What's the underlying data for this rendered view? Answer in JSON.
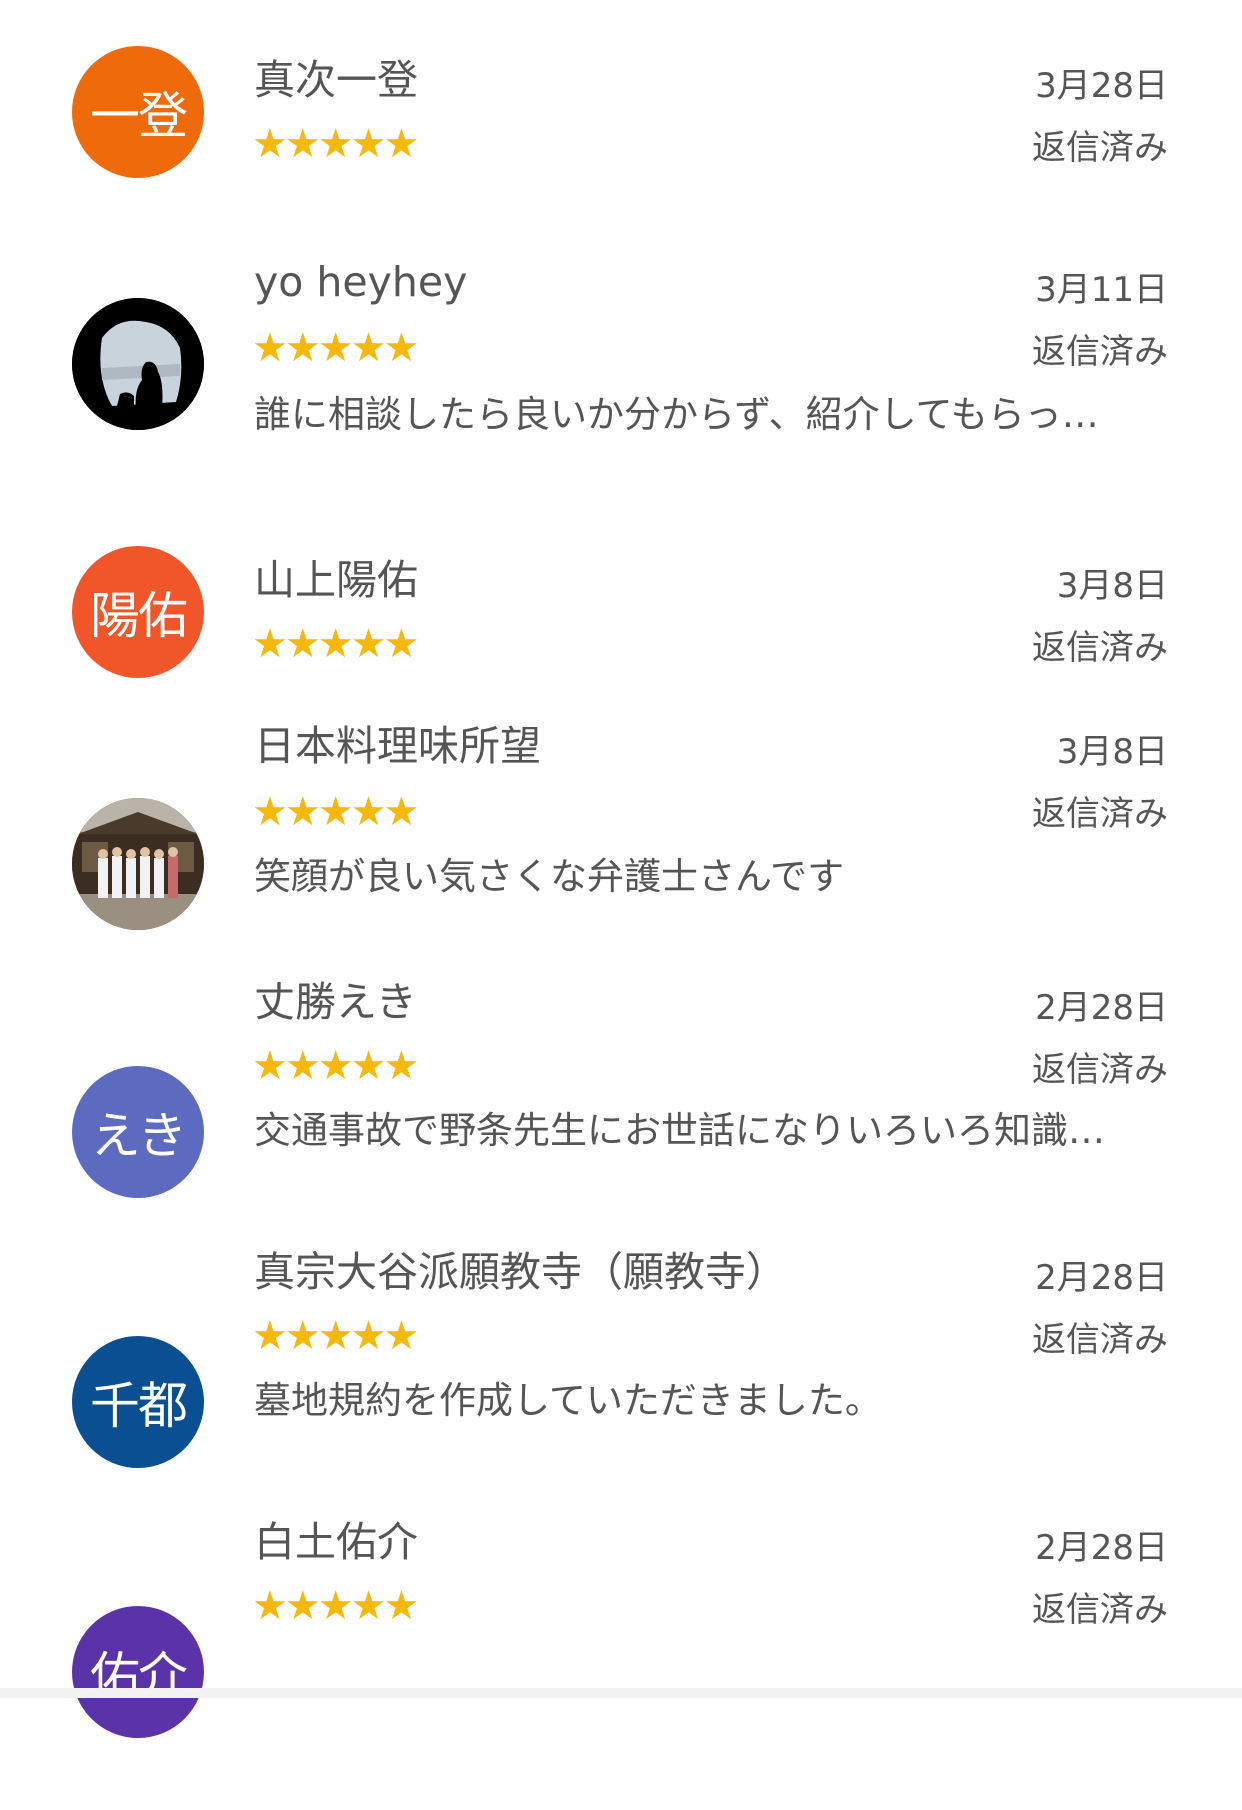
{
  "colors": {
    "star": "#f6b80b",
    "text": "#555555"
  },
  "reviews": [
    {
      "name": "真次一登",
      "avatar_text": "一登",
      "avatar_color": "#ee6a0a",
      "avatar_type": "initials",
      "stars": "★★★★★",
      "rating": 5,
      "date": "3月28日",
      "status": "返信済み",
      "snippet": ""
    },
    {
      "name": "yo heyhey",
      "avatar_text": "",
      "avatar_color": "#000000",
      "avatar_type": "photo",
      "avatar_icon": "cave-silhouette-photo",
      "stars": "★★★★★",
      "rating": 5,
      "date": "3月11日",
      "status": "返信済み",
      "snippet": "誰に相談したら良いか分からず、紹介してもらっ…"
    },
    {
      "name": "山上陽佑",
      "avatar_text": "陽佑",
      "avatar_color": "#f1552a",
      "avatar_type": "initials",
      "stars": "★★★★★",
      "rating": 5,
      "date": "3月8日",
      "status": "返信済み",
      "snippet": ""
    },
    {
      "name": "日本料理味所望",
      "avatar_text": "",
      "avatar_color": "#6b5a48",
      "avatar_type": "photo",
      "avatar_icon": "restaurant-staff-photo",
      "stars": "★★★★★",
      "rating": 5,
      "date": "3月8日",
      "status": "返信済み",
      "snippet": "笑顔が良い気さくな弁護士さんです"
    },
    {
      "name": "丈勝えき",
      "avatar_text": "えき",
      "avatar_color": "#5c6bc0",
      "avatar_type": "initials",
      "stars": "★★★★★",
      "rating": 5,
      "date": "2月28日",
      "status": "返信済み",
      "snippet": "交通事故で野条先生にお世話になりいろいろ知識…"
    },
    {
      "name": "真宗大谷派願教寺（願教寺）",
      "avatar_text": "千都",
      "avatar_color": "#0b4f93",
      "avatar_type": "initials",
      "stars": "★★★★★",
      "rating": 5,
      "date": "2月28日",
      "status": "返信済み",
      "snippet": "墓地規約を作成していただきました。"
    },
    {
      "name": "白土佑介",
      "avatar_text": "佑介",
      "avatar_color": "#5b33a8",
      "avatar_type": "initials",
      "stars": "★★★★★",
      "rating": 5,
      "date": "2月28日",
      "status": "返信済み",
      "snippet": ""
    }
  ]
}
